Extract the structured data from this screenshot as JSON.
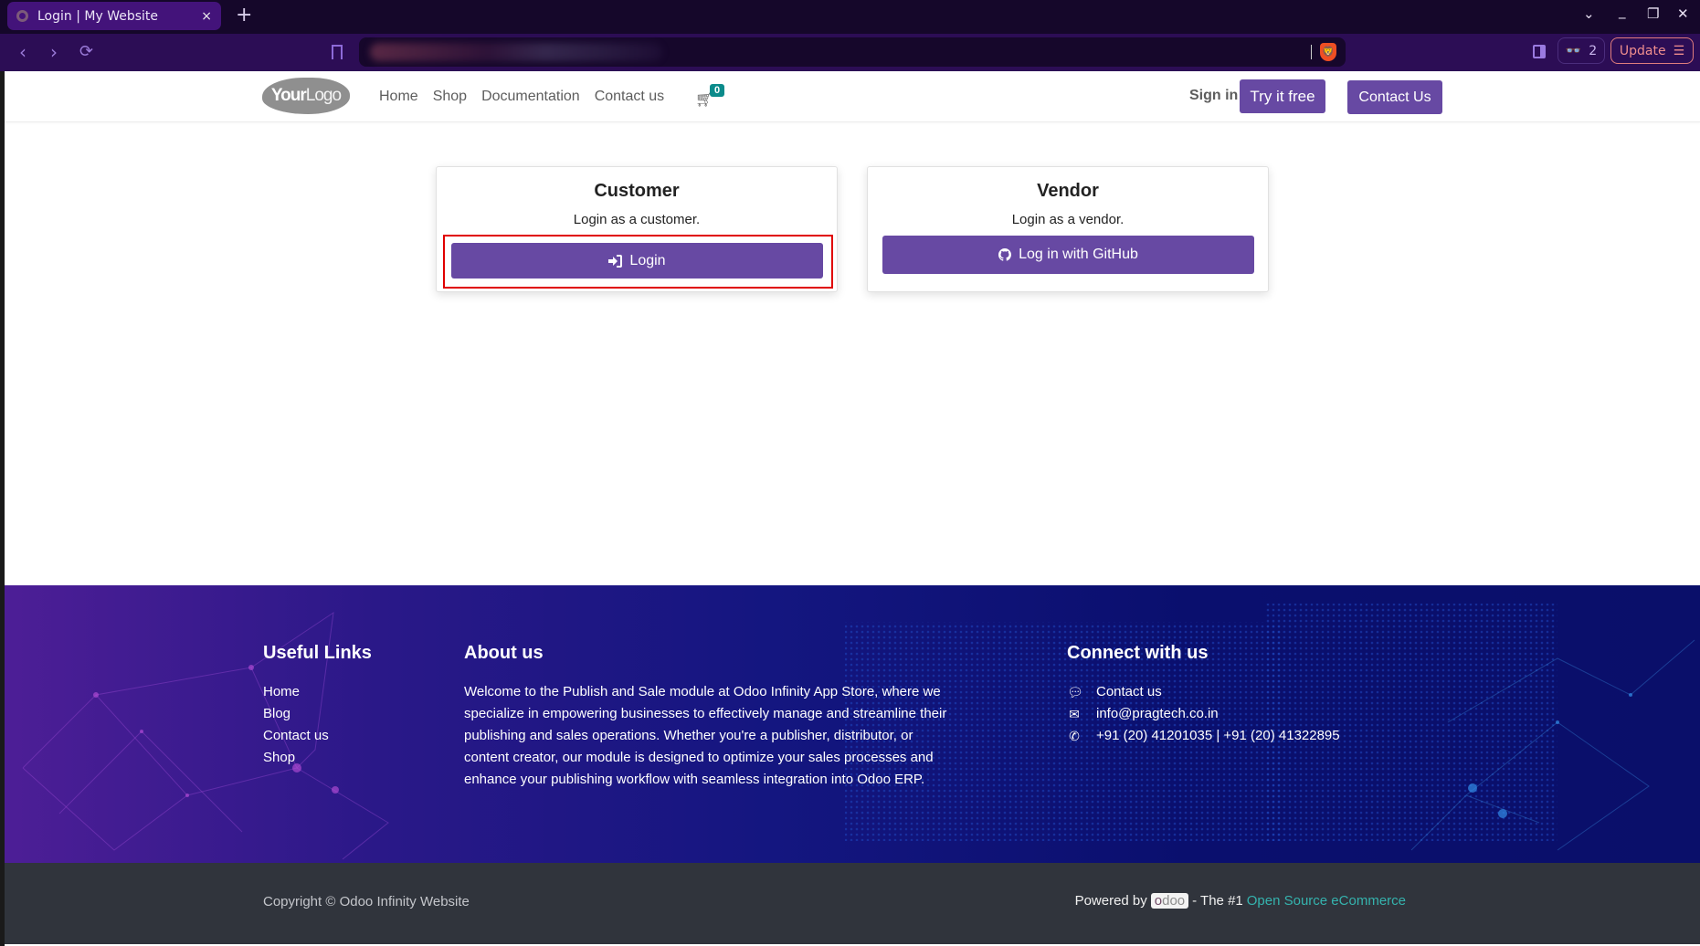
{
  "browser": {
    "tab_title": "Login | My Website",
    "tab_close": "×",
    "new_tab": "+",
    "window_controls": {
      "tab_list": "⌄",
      "minimize": "_",
      "restore": "❐",
      "close": "✕"
    },
    "nav": {
      "back": "‹",
      "forward": "›",
      "reload": "⟳"
    },
    "shields_count": "2",
    "update_label": "Update",
    "menu_icon": "☰"
  },
  "header": {
    "logo": {
      "bold": "Your",
      "light": "Logo"
    },
    "nav": [
      {
        "label": "Home"
      },
      {
        "label": "Shop"
      },
      {
        "label": "Documentation"
      },
      {
        "label": "Contact us"
      }
    ],
    "cart_count": "0",
    "sign_in": "Sign in",
    "try_free": "Try it free",
    "contact_us": "Contact Us"
  },
  "cards": {
    "customer": {
      "title": "Customer",
      "subtitle": "Login as a customer.",
      "button": "Login",
      "icon": "sign-in-icon"
    },
    "vendor": {
      "title": "Vendor",
      "subtitle": "Login as a vendor.",
      "button": "Log in with GitHub",
      "icon": "github-icon"
    }
  },
  "footer": {
    "useful_links": {
      "title": "Useful Links",
      "items": [
        {
          "label": "Home"
        },
        {
          "label": "Blog"
        },
        {
          "label": "Contact us"
        },
        {
          "label": "Shop"
        }
      ]
    },
    "about": {
      "title": "About us",
      "text": "Welcome to the Publish and Sale module at Odoo Infinity App Store, where we specialize in empowering businesses to effectively manage and streamline their publishing and sales operations. Whether you're a publisher, distributor, or content creator, our module is designed to optimize your sales processes and enhance your publishing workflow with seamless integration into Odoo ERP."
    },
    "connect": {
      "title": "Connect with us",
      "items": [
        {
          "icon": "comment-icon",
          "label": "Contact us"
        },
        {
          "icon": "envelope-icon",
          "label": "info@pragtech.co.in"
        },
        {
          "icon": "phone-icon",
          "label": "+91 (20) 41201035 | +91 (20) 41322895"
        }
      ]
    }
  },
  "copyright": {
    "text": "Copyright © Odoo Infinity Website",
    "powered_by": "Powered by",
    "odoo_o": "o",
    "odoo_rest": "doo",
    "tagline": "- The #1",
    "link": "Open Source eCommerce"
  },
  "colors": {
    "primary": "#6749a3",
    "badge": "#0b8b8b",
    "highlight": "#e00000",
    "footer_dark": "#30343c",
    "link_teal": "#35b3ae"
  }
}
